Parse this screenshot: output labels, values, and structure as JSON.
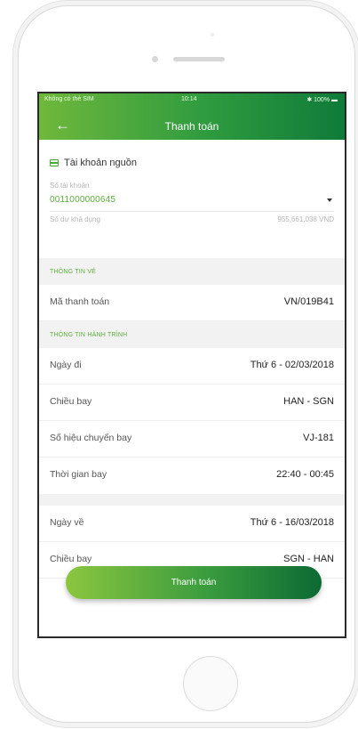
{
  "status_bar": {
    "carrier": "Không có thẻ SIM",
    "time": "10:14",
    "battery": "100%"
  },
  "nav": {
    "title": "Thanh toán"
  },
  "source_account": {
    "title": "Tài khoản nguồn",
    "account_label": "Số tài khoản",
    "account_number": "0011000000645",
    "balance_label": "Số dư khả dụng",
    "balance_value": "955,661,038 VND"
  },
  "ticket_section": {
    "heading": "THÔNG TIN VÉ",
    "payment_code_label": "Mã thanh toán",
    "payment_code_value": "VN/019B41"
  },
  "itinerary_section": {
    "heading": "THÔNG TIN HÀNH TRÌNH",
    "outbound": [
      {
        "label": "Ngày đi",
        "value": "Thứ 6 - 02/03/2018"
      },
      {
        "label": "Chiều bay",
        "value": "HAN - SGN"
      },
      {
        "label": "Số hiệu chuyến bay",
        "value": "VJ-181"
      },
      {
        "label": "Thời gian bay",
        "value": "22:40 - 00:45"
      }
    ],
    "return": [
      {
        "label": "Ngày về",
        "value": "Thứ 6 - 16/03/2018"
      },
      {
        "label": "Chiều bay",
        "value": "SGN - HAN"
      }
    ]
  },
  "pay_button": {
    "label": "Thanh toán"
  },
  "colors": {
    "brand_green": "#2e9b3f",
    "accent_green": "#5cad3c"
  }
}
